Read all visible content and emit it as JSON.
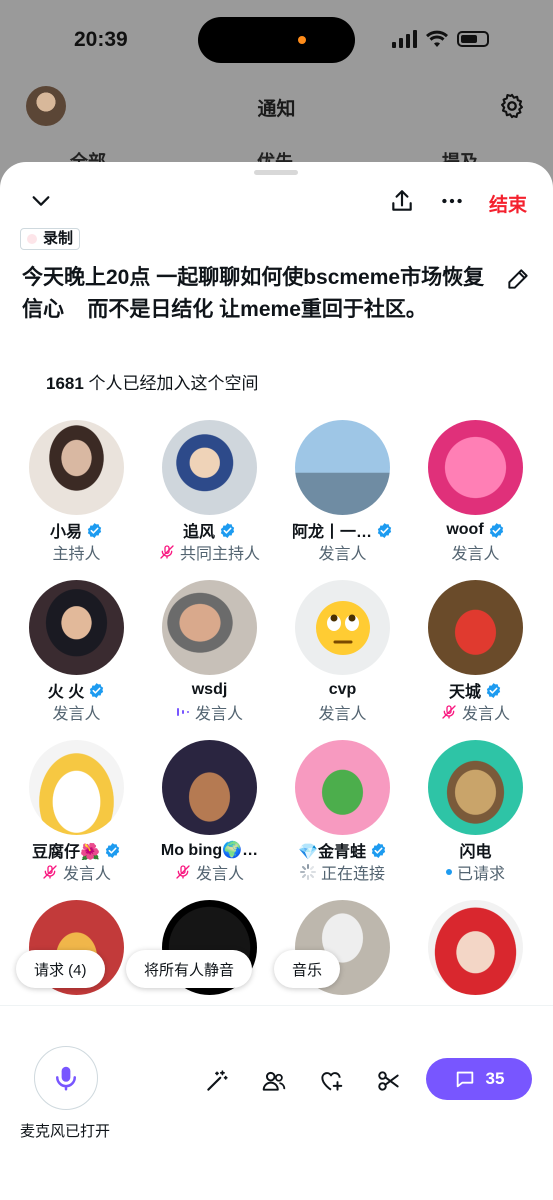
{
  "status_bar": {
    "time": "20:39"
  },
  "background_page": {
    "title": "通知",
    "tabs": [
      "全部",
      "优先",
      "提及"
    ]
  },
  "sheet": {
    "end_label": "结束",
    "recording_label": "录制",
    "title": "今天晚上20点 一起聊聊如何使bscmeme市场恢复信心    而不是日结化 让meme重回于社区。",
    "listeners_count": "1681",
    "listeners_text": " 个人已经加入这个空间",
    "participants": [
      {
        "name": "小易",
        "verified": true,
        "role": "主持人",
        "role_icon": "none"
      },
      {
        "name": "追风",
        "verified": true,
        "role": "共同主持人",
        "role_icon": "mic-off-icon"
      },
      {
        "name": "阿龙丨一…",
        "verified": true,
        "role": "发言人",
        "role_icon": "none"
      },
      {
        "name": "woof",
        "verified": true,
        "role": "发言人",
        "role_icon": "none"
      },
      {
        "name": "火 火",
        "verified": true,
        "role": "发言人",
        "role_icon": "none"
      },
      {
        "name": "wsdj",
        "verified": false,
        "role": "发言人",
        "role_icon": "speaking-bars-icon"
      },
      {
        "name": "cvp",
        "verified": false,
        "role": "发言人",
        "role_icon": "none"
      },
      {
        "name": "天城",
        "verified": true,
        "role": "发言人",
        "role_icon": "mic-off-icon"
      },
      {
        "name": "豆腐仔🌺",
        "verified": true,
        "role": "发言人",
        "role_icon": "mic-off-icon"
      },
      {
        "name": "Mo bing🌍…",
        "verified": false,
        "role": "发言人",
        "role_icon": "mic-off-icon"
      },
      {
        "name": "💎金青蛙",
        "verified": true,
        "role": "正在连接",
        "role_icon": "loading-spinner-icon"
      },
      {
        "name": "闪电",
        "verified": false,
        "role": "已请求",
        "role_icon": "blue-dot-icon"
      }
    ],
    "pills": {
      "requests": "请求 (4)",
      "mute_all": "将所有人静音",
      "music": "音乐"
    },
    "bottom_bar": {
      "mic_label": "麦克风已打开",
      "chat_count": "35"
    }
  },
  "colors": {
    "accent_purple": "#7856ff",
    "end_red": "#f4212e",
    "verified_blue": "#1d9bf0",
    "mute_pink": "#f91880"
  }
}
